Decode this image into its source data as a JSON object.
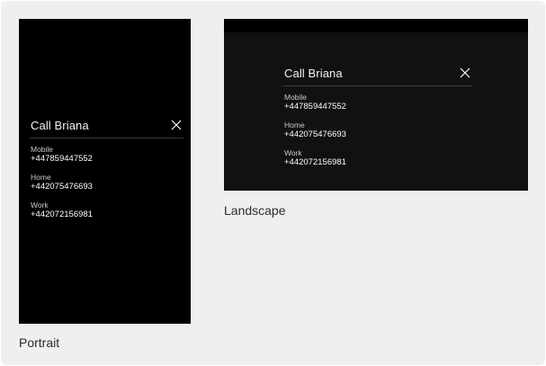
{
  "dialog": {
    "title": "Call Briana",
    "entries": [
      {
        "label": "Mobile",
        "number": "+447859447552"
      },
      {
        "label": "Home",
        "number": "+442075476693"
      },
      {
        "label": "Work",
        "number": "+442072156981"
      }
    ],
    "close_icon": "close-icon"
  },
  "captions": {
    "portrait": "Portrait",
    "landscape": "Landscape"
  },
  "colors": {
    "background": "#eeeff1",
    "screen": "#000000",
    "landscape_body": "#111111",
    "text_primary": "#ffffff",
    "text_secondary": "#c9c9c9",
    "divider": "#3a3a3a"
  }
}
